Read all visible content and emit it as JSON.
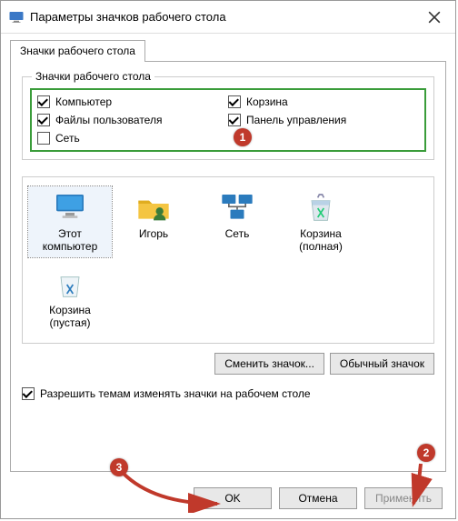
{
  "window": {
    "title": "Параметры значков рабочего стола"
  },
  "tab": {
    "label": "Значки рабочего стола"
  },
  "group": {
    "legend": "Значки рабочего стола"
  },
  "checks": {
    "computer": {
      "label": "Компьютер",
      "checked": true
    },
    "userfiles": {
      "label": "Файлы пользователя",
      "checked": true
    },
    "network": {
      "label": "Сеть",
      "checked": false
    },
    "recycle": {
      "label": "Корзина",
      "checked": true
    },
    "cpanel": {
      "label": "Панель управления",
      "checked": true
    }
  },
  "icons": [
    {
      "name": "this-pc",
      "label": "Этот\nкомпьютер"
    },
    {
      "name": "user-folder",
      "label": "Игорь"
    },
    {
      "name": "network",
      "label": "Сеть"
    },
    {
      "name": "recycle-full",
      "label": "Корзина\n(полная)"
    },
    {
      "name": "recycle-empty",
      "label": "Корзина\n(пустая)"
    }
  ],
  "buttons": {
    "change_icon": "Сменить значок...",
    "default_icon": "Обычный значок",
    "ok": "OK",
    "cancel": "Отмена",
    "apply": "Применить"
  },
  "allow_themes": {
    "label": "Разрешить темам изменять значки на рабочем столе",
    "checked": true
  },
  "annotations": {
    "b1": "1",
    "b2": "2",
    "b3": "3"
  }
}
